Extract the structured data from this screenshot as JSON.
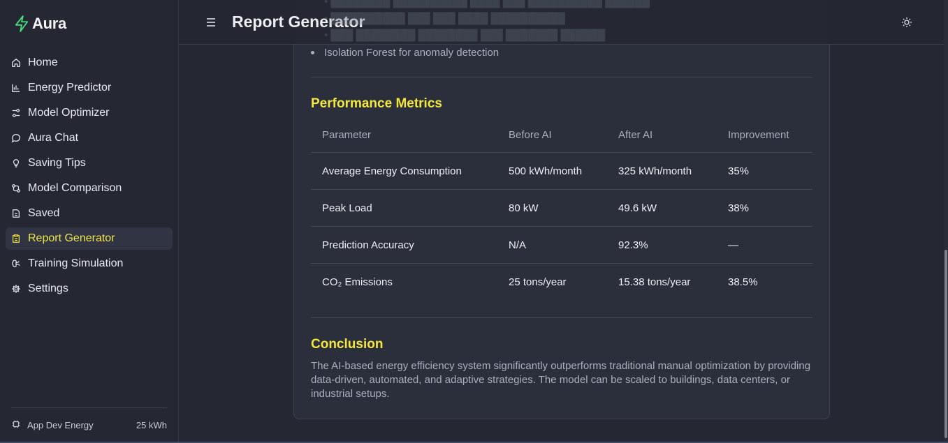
{
  "brand": {
    "name": "Aura",
    "accent_color": "#4ade80"
  },
  "sidebar": {
    "items": [
      {
        "label": "Home",
        "icon": "home-icon",
        "active": false
      },
      {
        "label": "Energy Predictor",
        "icon": "bar-chart-icon",
        "active": false
      },
      {
        "label": "Model Optimizer",
        "icon": "sliders-icon",
        "active": false
      },
      {
        "label": "Aura Chat",
        "icon": "chat-bubble-icon",
        "active": false
      },
      {
        "label": "Saving Tips",
        "icon": "lightbulb-icon",
        "active": false
      },
      {
        "label": "Model Comparison",
        "icon": "compare-icon",
        "active": false
      },
      {
        "label": "Saved",
        "icon": "document-icon",
        "active": false
      },
      {
        "label": "Report Generator",
        "icon": "clipboard-icon",
        "active": true
      },
      {
        "label": "Training Simulation",
        "icon": "brain-icon",
        "active": false
      },
      {
        "label": "Settings",
        "icon": "gear-icon",
        "active": false
      }
    ],
    "footer": {
      "label": "App Dev Energy",
      "value": "25 kWh",
      "icon": "cpu-icon"
    }
  },
  "header": {
    "title": "Report Generator",
    "menu_icon": "hamburger-icon",
    "theme_icon": "sun-icon"
  },
  "report": {
    "bullet_visible": "Isolation Forest for anomaly detection",
    "metrics_title": "Performance Metrics",
    "table": {
      "headers": [
        "Parameter",
        "Before AI",
        "After AI",
        "Improvement"
      ],
      "rows": [
        [
          "Average Energy Consumption",
          "500 kWh/month",
          "325 kWh/month",
          "35%"
        ],
        [
          "Peak Load",
          "80 kW",
          "49.6 kW",
          "38%"
        ],
        [
          "Prediction Accuracy",
          "N/A",
          "92.3%",
          "—"
        ],
        [
          "CO₂ Emissions",
          "25 tons/year",
          "15.38 tons/year",
          "38.5%"
        ]
      ]
    },
    "conclusion_title": "Conclusion",
    "conclusion_text": "The AI-based energy efficiency system significantly outperforms traditional manual optimization by providing data-driven, automated, and adaptive strategies. The model can be scaled to buildings, data centers, or industrial setups."
  },
  "colors": {
    "accent_yellow": "#f3e63f",
    "background": "#252833",
    "card": "#2b2f3b"
  }
}
